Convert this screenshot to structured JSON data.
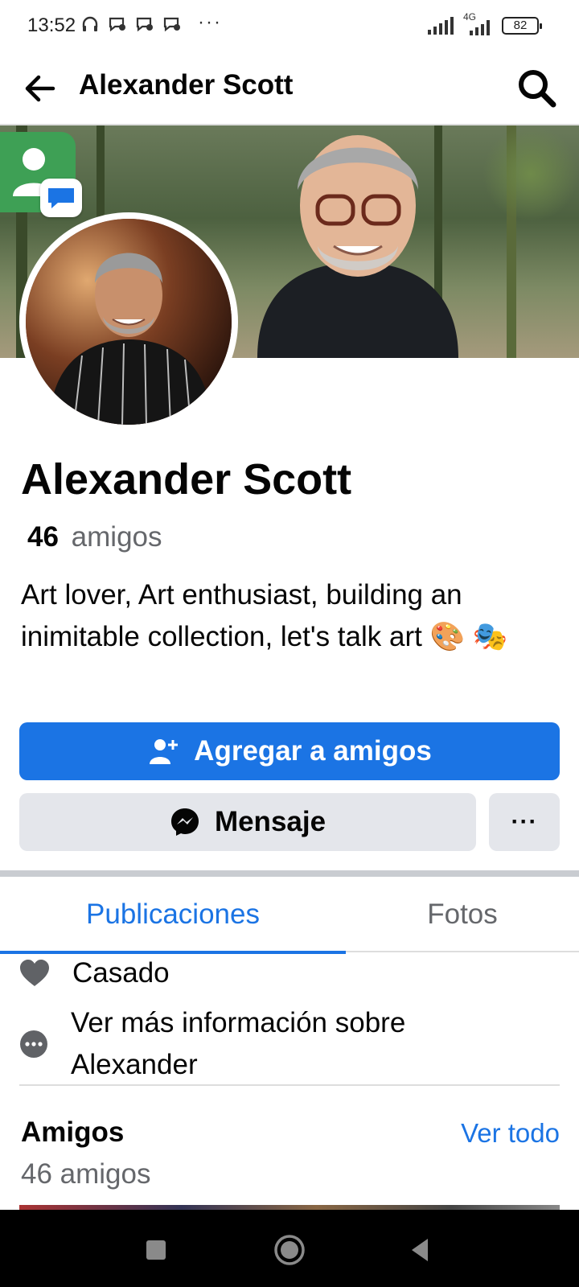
{
  "status_bar": {
    "time": "13:52",
    "battery": "82",
    "network": "4G",
    "overflow": "···"
  },
  "header": {
    "title": "Alexander Scott"
  },
  "profile": {
    "name": "Alexander Scott",
    "friends_count": "46",
    "friends_word": "amigos",
    "bio": "Art lover, Art enthusiast, building an inimitable collection, let's talk art 🎨 🎭"
  },
  "actions": {
    "add_friend": "Agregar a amigos",
    "message": "Mensaje",
    "more": "···"
  },
  "tabs": {
    "posts": "Publicaciones",
    "photos": "Fotos"
  },
  "details": {
    "relationship": "Casado",
    "more_info": "Ver más información sobre Alexander"
  },
  "friends_section": {
    "heading": "Amigos",
    "see_all": "Ver todo",
    "count_text": "46 amigos"
  },
  "colors": {
    "accent": "#1b74e4",
    "secondary_button": "#e4e6eb"
  },
  "icons": [
    "back-arrow-icon",
    "search-icon",
    "add-friend-icon",
    "messenger-icon",
    "heart-icon",
    "more-dots-icon",
    "square-nav-icon",
    "home-nav-icon",
    "back-nav-icon"
  ]
}
